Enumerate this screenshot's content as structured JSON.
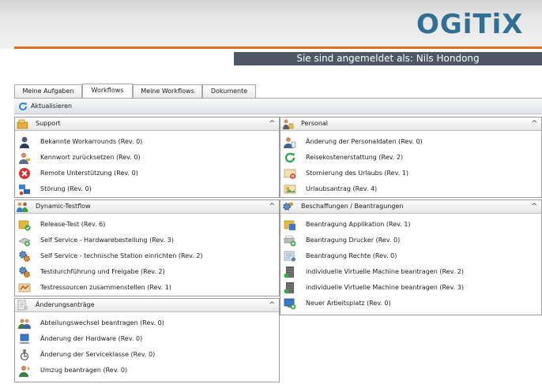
{
  "header": {
    "logo_text": "OGiTiX",
    "logo_color": "#2f6f93",
    "accent_color": "#e2701e",
    "login_text": "Sie sind angemeldet als: Nils Hondong"
  },
  "tabs": [
    {
      "label": "Meine Aufgaben",
      "active": false
    },
    {
      "label": "Workflows",
      "active": true
    },
    {
      "label": "Meine Workflows",
      "active": false
    },
    {
      "label": "Dokumente",
      "active": false
    }
  ],
  "toolbar": {
    "refresh_label": "Aktualisieren",
    "refresh_icon": "refresh-icon"
  },
  "panels": {
    "support": {
      "title": "Support",
      "icon": "folder-box-icon",
      "collapse": "^",
      "items": [
        {
          "label": "Bekannte Workarrounds (Rev. 0)",
          "icon": "user-agent-icon"
        },
        {
          "label": "Kennwort zurücksetzen (Rev. 0)",
          "icon": "user-key-icon"
        },
        {
          "label": "Remote Unterstützung (Rev. 0)",
          "icon": "remote-error-icon"
        },
        {
          "label": "Störung (Rev. 0)",
          "icon": "network-issue-icon"
        }
      ]
    },
    "dynamic": {
      "title": "Dynamic-Testflow",
      "icon": "people-group-icon",
      "collapse": "^",
      "items": [
        {
          "label": "Release-Test (Rev. 6)",
          "icon": "folder-check-icon"
        },
        {
          "label": "Self Service - Hardwarebestellung (Rev. 3)",
          "icon": "hardware-order-icon"
        },
        {
          "label": "Self Service - technische Station einrichten (Rev. 2)",
          "icon": "gears-icon"
        },
        {
          "label": "Testdurchführung und Freigabe (Rev. 2)",
          "icon": "gears-icon"
        },
        {
          "label": "Testressourcen zusammenstellen (Rev. 1)",
          "icon": "resources-icon"
        }
      ]
    },
    "aenderung": {
      "title": "Änderungsanträge",
      "icon": "document-change-icon",
      "collapse": "^",
      "items": [
        {
          "label": "Abteilungswechsel beantragen (Rev. 0)",
          "icon": "users-transfer-icon"
        },
        {
          "label": "Änderung der Hardware (Rev. 0)",
          "icon": "laptop-icon"
        },
        {
          "label": "Änderung der Serviceklasse (Rev. 0)",
          "icon": "service-class-icon"
        },
        {
          "label": "Umzug beantragen (Rev. 0)",
          "icon": "user-move-icon"
        }
      ]
    },
    "personal": {
      "title": "Personal",
      "icon": "personnel-icon",
      "collapse": "^",
      "items": [
        {
          "label": "Änderung der Personaldaten (Rev. 0)",
          "icon": "user-data-icon"
        },
        {
          "label": "Reisekostenerstattung (Rev. 2)",
          "icon": "refund-icon"
        },
        {
          "label": "Stornierung des Urlaubs (Rev. 1)",
          "icon": "vacation-cancel-icon"
        },
        {
          "label": "Urlaubsantrag (Rev. 4)",
          "icon": "vacation-request-icon"
        }
      ]
    },
    "beschaffung": {
      "title": "Beschaffungen / Beantragungen",
      "icon": "procurement-icon",
      "collapse": "^",
      "items": [
        {
          "label": "Beantragung Applikation (Rev. 1)",
          "icon": "application-request-icon"
        },
        {
          "label": "Beantragung Drucker (Rev. 0)",
          "icon": "printer-add-icon"
        },
        {
          "label": "Beantragung Rechte (Rev. 0)",
          "icon": "rights-request-icon"
        },
        {
          "label": "individuelle Virtuelle Machine beantragen (Rev. 2)",
          "icon": "server-stack-icon"
        },
        {
          "label": "individuelle Virtuelle Machine beantragen (Rev. 3)",
          "icon": "server-stack-icon"
        },
        {
          "label": "Neuer Arbeitsplatz (Rev. 0)",
          "icon": "workstation-add-icon"
        }
      ]
    }
  }
}
